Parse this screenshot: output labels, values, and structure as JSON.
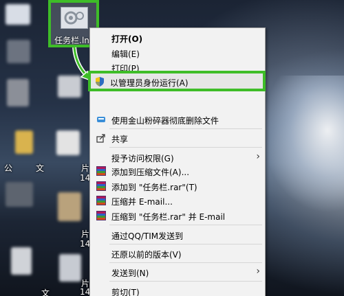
{
  "desktop": {
    "icon_label": "任务栏.lnk",
    "left_labels": [
      "公",
      "文",
      "片",
      "14",
      "片",
      "14",
      "片",
      "14",
      "文"
    ]
  },
  "menu": {
    "items": [
      {
        "label": "打开(O)",
        "icon": "",
        "bold": true
      },
      {
        "label": "编辑(E)",
        "icon": ""
      },
      {
        "label": "打印(P)",
        "icon": ""
      },
      {
        "label": "以管理员身份运行(A)",
        "icon": "uac-shield-icon",
        "highlighted": true
      },
      {
        "label": "使用金山粉碎器彻底删除文件",
        "icon": "shredder-icon"
      },
      {
        "label": "共享",
        "icon": "share-icon"
      },
      {
        "label": "授予访问权限(G)",
        "icon": "",
        "submenu": true
      },
      {
        "label": "添加到压缩文件(A)...",
        "icon": "winrar-icon"
      },
      {
        "label": "添加到 \"任务栏.rar\"(T)",
        "icon": "winrar-icon"
      },
      {
        "label": "压缩并 E-mail...",
        "icon": "winrar-icon"
      },
      {
        "label": "压缩到 \"任务栏.rar\" 并 E-mail",
        "icon": "winrar-icon"
      },
      {
        "label": "通过QQ/TIM发送到",
        "icon": ""
      },
      {
        "label": "还原以前的版本(V)",
        "icon": ""
      },
      {
        "label": "发送到(N)",
        "icon": "",
        "submenu": true
      },
      {
        "label": "剪切(T)",
        "icon": ""
      }
    ]
  },
  "colors": {
    "highlight": "#3ebd28",
    "menu_bg": "#f2f2f2"
  }
}
